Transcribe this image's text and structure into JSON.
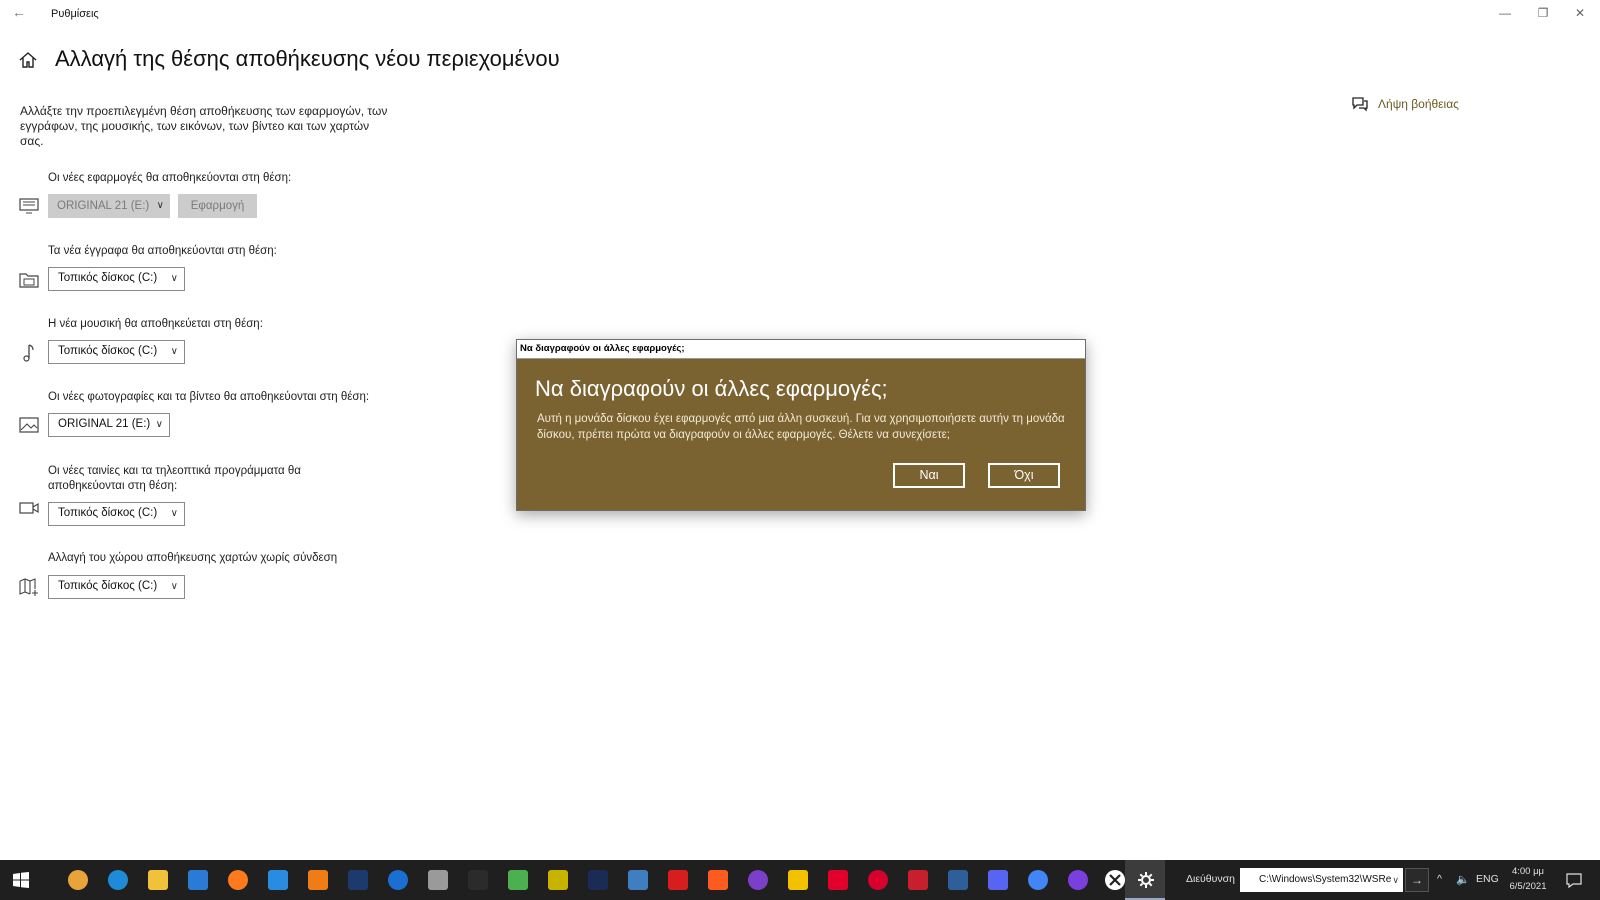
{
  "window": {
    "title": "Ρυθμίσεις",
    "back_glyph": "←",
    "minimize_glyph": "—",
    "restore_glyph": "❐",
    "close_glyph": "✕"
  },
  "page": {
    "title": "Αλλαγή της θέσης αποθήκευσης νέου περιεχομένου",
    "description": "Αλλάξτε την προεπιλεγμένη θέση αποθήκευσης των εφαρμογών, των εγγράφων, της μουσικής, των εικόνων, των βίντεο και των χαρτών σας.",
    "help_link": "Λήψη βοήθειας"
  },
  "sections": {
    "apps": {
      "label": "Οι νέες εφαρμογές θα αποθηκεύονται στη θέση:",
      "value": "ORIGINAL 21 (E:)",
      "apply": "Εφαρμογή",
      "icon": "monitor-icon"
    },
    "documents": {
      "label": "Τα νέα έγγραφα θα αποθηκεύονται στη θέση:",
      "value": "Τοπικός δίσκος (C:)",
      "icon": "folder-icon"
    },
    "music": {
      "label": "Η νέα μουσική θα αποθηκεύεται στη θέση:",
      "value": "Τοπικός δίσκος (C:)",
      "icon": "music-note-icon"
    },
    "photos": {
      "label": "Οι νέες φωτογραφίες και τα βίντεο θα αποθηκεύονται στη θέση:",
      "value": "ORIGINAL 21 (E:)",
      "icon": "picture-icon"
    },
    "movies": {
      "label": "Οι νέες ταινίες και τα τηλεοπτικά προγράμματα θα αποθηκεύονται στη θέση:",
      "value": "Τοπικός δίσκος (C:)",
      "icon": "video-camera-icon"
    },
    "maps": {
      "label": "Αλλαγή του χώρου αποθήκευσης χαρτών χωρίς σύνδεση",
      "value": "Τοπικός δίσκος (C:)",
      "icon": "map-icon"
    }
  },
  "dialog": {
    "window_title": "Να διαγραφούν οι άλλες εφαρμογές;",
    "heading": "Να διαγραφούν οι άλλες εφαρμογές;",
    "message": "Αυτή η μονάδα δίσκου έχει εφαρμογές από μια άλλη συσκευή. Για να χρησιμοποιήσετε αυτήν τη μονάδα δίσκου, πρέπει πρώτα να διαγραφούν οι άλλες εφαρμογές. Θέλετε να συνεχίσετε;",
    "yes": "Ναι",
    "no": "Όχι",
    "background_color": "#7a6330"
  },
  "taskbar": {
    "address_label": "Διεύθυνση",
    "address_value": "C:\\Windows\\System32\\WSRe",
    "go_glyph": "→",
    "tray_chevron": "^",
    "volume_glyph": "🔈",
    "language": "ENG",
    "time": "4:00 μμ",
    "date": "6/5/2021",
    "apps": [
      "chrome-canary-icon",
      "edge-icon",
      "file-explorer-icon",
      "store-icon",
      "firefox-icon",
      "mail-icon",
      "vlc-icon",
      "steam-icon",
      "uplay-icon",
      "launcher-icon",
      "epic-games-icon",
      "xbox-icon",
      "game-icon",
      "dark-icon",
      "photos-icon",
      "acrobat-icon",
      "origin-icon",
      "visual-studio-icon",
      "rockstar-icon",
      "heart-icon",
      "creative-cloud-icon",
      "filezilla-icon",
      "remote-desktop-icon",
      "discord-icon",
      "chrome-icon",
      "cortana-icon",
      "xbox-app-icon",
      "settings-icon"
    ]
  }
}
